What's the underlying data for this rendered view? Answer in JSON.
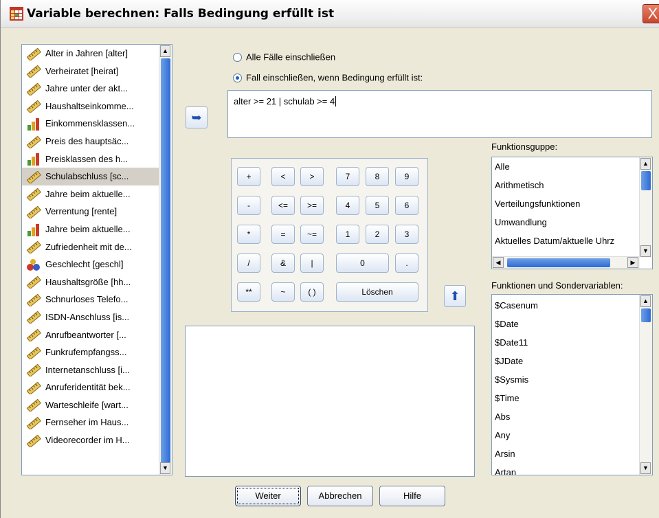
{
  "window": {
    "title": "Variable berechnen: Falls Bedingung erfüllt ist",
    "close_symbol": "X"
  },
  "variables": [
    {
      "label": "Alter in Jahren [alter]",
      "icon": "ruler-icon"
    },
    {
      "label": "Verheiratet [heirat]",
      "icon": "ruler-icon"
    },
    {
      "label": "Jahre unter der akt...",
      "icon": "ruler-icon"
    },
    {
      "label": "Haushaltseinkomme...",
      "icon": "ruler-icon"
    },
    {
      "label": "Einkommensklassen...",
      "icon": "bar-chart-icon"
    },
    {
      "label": "Preis des hauptsäc...",
      "icon": "ruler-icon"
    },
    {
      "label": "Preisklassen des h...",
      "icon": "bar-chart-icon"
    },
    {
      "label": "Schulabschluss [sc...",
      "icon": "ruler-icon",
      "selected": true
    },
    {
      "label": "Jahre beim aktuelle...",
      "icon": "ruler-icon"
    },
    {
      "label": "Verrentung [rente]",
      "icon": "ruler-icon"
    },
    {
      "label": "Jahre beim aktuelle...",
      "icon": "bar-chart-icon"
    },
    {
      "label": "Zufriedenheit mit de...",
      "icon": "ruler-icon"
    },
    {
      "label": "Geschlecht [geschl]",
      "icon": "nominal-icon"
    },
    {
      "label": "Haushaltsgröße [hh...",
      "icon": "ruler-icon"
    },
    {
      "label": "Schnurloses Telefo...",
      "icon": "ruler-icon"
    },
    {
      "label": "ISDN-Anschluss [is...",
      "icon": "ruler-icon"
    },
    {
      "label": "Anrufbeantworter [...",
      "icon": "ruler-icon"
    },
    {
      "label": "Funkrufempfangss...",
      "icon": "ruler-icon"
    },
    {
      "label": "Internetanschluss [i...",
      "icon": "ruler-icon"
    },
    {
      "label": "Anruferidentität bek...",
      "icon": "ruler-icon"
    },
    {
      "label": "Warteschleife [wart...",
      "icon": "ruler-icon"
    },
    {
      "label": "Fernseher im Haus...",
      "icon": "ruler-icon"
    },
    {
      "label": "Videorecorder im H...",
      "icon": "ruler-icon"
    }
  ],
  "radios": {
    "all_cases": "Alle Fälle einschließen",
    "if_condition": "Fall einschließen, wenn Bedingung erfüllt ist:",
    "selected": "if_condition"
  },
  "condition_expression": "alter >= 21 | schulab >= 4",
  "keypad": {
    "plus": "+",
    "lt": "<",
    "gt": ">",
    "k7": "7",
    "k8": "8",
    "k9": "9",
    "minus": "-",
    "le": "<=",
    "ge": ">=",
    "k4": "4",
    "k5": "5",
    "k6": "6",
    "mult": "*",
    "eq": "=",
    "ne": "~=",
    "k1": "1",
    "k2": "2",
    "k3": "3",
    "div": "/",
    "and": "&",
    "or": "|",
    "k0": "0",
    "dot": ".",
    "pow": "**",
    "not": "~",
    "paren": "( )",
    "clear": "Löschen"
  },
  "function_group": {
    "label": "Funktionsguppe:",
    "items": [
      "Alle",
      "Arithmetisch",
      "Verteilungsfunktionen",
      "Umwandlung",
      "Aktuelles Datum/aktuelle Uhrz"
    ]
  },
  "functions": {
    "label": "Funktionen und Sondervariablen:",
    "items": [
      "$Casenum",
      "$Date",
      "$Date11",
      "$JDate",
      "$Sysmis",
      "$Time",
      "Abs",
      "Any",
      "Arsin",
      "Artan"
    ]
  },
  "buttons": {
    "continue": "Weiter",
    "cancel": "Abbrechen",
    "help": "Hilfe"
  },
  "colors": {
    "selection": "#d4d0c8",
    "scroll_thumb": "#2d6bd6",
    "close": "#c8452a"
  }
}
